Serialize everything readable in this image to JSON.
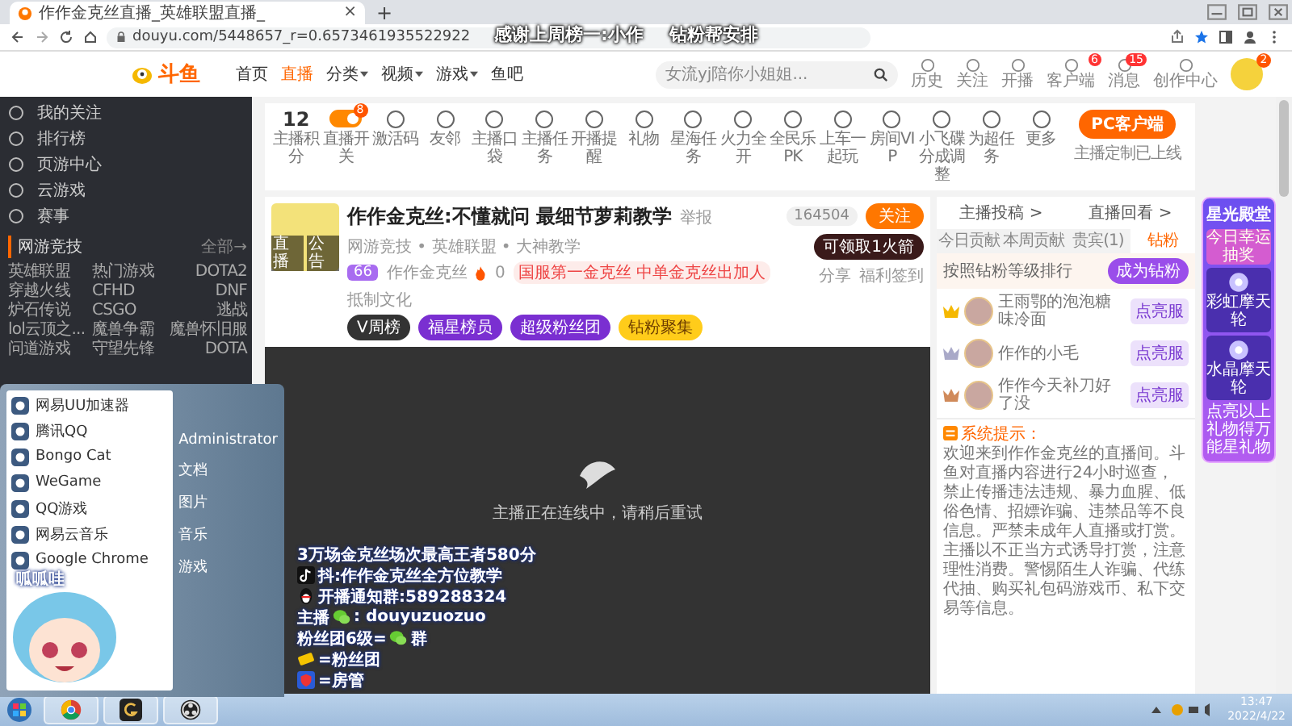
{
  "overlay_caption": [
    "感谢上周榜一:小作",
    "钻粉帮安排"
  ],
  "browser": {
    "tab_title": "作作金克丝直播_英雄联盟直播_",
    "tab_close": "×",
    "new_tab": "+",
    "url": "douyu.com/5448657_r=0.6573461935522922"
  },
  "site_header": {
    "logo": "斗鱼",
    "nav": [
      {
        "label": "首页",
        "selected": false,
        "dropdown": false
      },
      {
        "label": "直播",
        "selected": true,
        "dropdown": false
      },
      {
        "label": "分类",
        "selected": false,
        "dropdown": true
      },
      {
        "label": "视频",
        "selected": false,
        "dropdown": true
      },
      {
        "label": "游戏",
        "selected": false,
        "dropdown": true
      },
      {
        "label": "鱼吧",
        "selected": false,
        "dropdown": false
      }
    ],
    "search": {
      "placeholder": "女流yj陪你小姐姐..."
    },
    "actions": [
      {
        "label": "历史"
      },
      {
        "label": "关注"
      },
      {
        "label": "开播"
      },
      {
        "label": "客户端",
        "badge": "6"
      },
      {
        "label": "消息",
        "badge": "15"
      },
      {
        "label": "创作中心"
      }
    ],
    "avatar_badge": "2"
  },
  "sidebar": {
    "items": [
      {
        "label": "我的关注"
      },
      {
        "label": "排行榜"
      },
      {
        "label": "页游中心"
      },
      {
        "label": "云游戏"
      },
      {
        "label": "赛事"
      }
    ],
    "section": {
      "title": "网游竞技",
      "more": "全部→"
    },
    "games": [
      "英雄联盟",
      "热门游戏",
      "DOTA2",
      "穿越火线",
      "CFHD",
      "DNF",
      "炉石传说",
      "CSGO",
      "逃战",
      "lol云顶之...",
      "魔兽争霸",
      "魔兽怀旧服",
      "问道游戏",
      "守望先锋",
      "DOTA"
    ]
  },
  "toolbar": {
    "items": [
      {
        "kind": "score",
        "value": "12",
        "label": "主播积分"
      },
      {
        "kind": "toggle",
        "on": true,
        "badge": "8",
        "label": "直播开关"
      },
      {
        "kind": "icon",
        "label": "激活码"
      },
      {
        "kind": "icon",
        "label": "友邻"
      },
      {
        "kind": "icon",
        "label": "主播口袋"
      },
      {
        "kind": "icon",
        "label": "主播任务"
      },
      {
        "kind": "icon",
        "label": "开播提醒"
      },
      {
        "kind": "icon",
        "label": "礼物"
      },
      {
        "kind": "icon",
        "label": "星海任务"
      },
      {
        "kind": "icon",
        "label": "火力全开"
      },
      {
        "kind": "icon",
        "label": "全民乐PK"
      },
      {
        "kind": "icon",
        "label": "上车一起玩"
      },
      {
        "kind": "icon",
        "label": "房间VIP"
      },
      {
        "kind": "icon",
        "label": "小飞碟分成调整"
      },
      {
        "kind": "icon",
        "label": "为超任务"
      },
      {
        "kind": "icon",
        "label": "更多"
      }
    ],
    "client_button": "PC客户端",
    "client_note": "主播定制已上线"
  },
  "room": {
    "title": "作作金克丝:不懂就问 最细节萝莉教学",
    "report": "举报",
    "category": "网游竞技 • 英雄联盟 • 大神教学",
    "level": "66",
    "anchor": "作作金克丝",
    "heat": "0",
    "slogan": "国服第一金克丝 中单金克丝出加人",
    "culture": "抵制文化",
    "avatar_tags": [
      "直播",
      "公告"
    ],
    "tags": [
      {
        "label": "V周榜",
        "kind": "dark"
      },
      {
        "label": "福星榜员",
        "kind": "purple"
      },
      {
        "label": "超级粉丝团",
        "kind": "purple"
      },
      {
        "label": "钻粉聚集",
        "kind": "gold"
      }
    ],
    "followers": "164504",
    "follow_button": "关注",
    "rocket": "可领取1火箭",
    "share": "分享",
    "checkin": "福利签到"
  },
  "video": {
    "status": "主播正在连线中，请稍后重试"
  },
  "side_panel": {
    "links": [
      "主播投稿 >",
      "直播回看 >"
    ],
    "tabs": [
      {
        "label": "今日贡献",
        "selected": false
      },
      {
        "label": "本周贡献",
        "selected": false
      },
      {
        "label": "贵宾(1)",
        "selected": false
      },
      {
        "label": "钻粉",
        "selected": true
      }
    ],
    "rank_title": "按照钻粉等级排行",
    "join_button": "成为钻粉",
    "ranks": [
      {
        "name": "王雨鄂的泡泡糖味冷面",
        "color": "#f5b800",
        "action": "点亮服"
      },
      {
        "name": "作作的小毛",
        "color": "#a9a9c8",
        "action": "点亮服"
      },
      {
        "name": "作作今天补刀好了没",
        "color": "#d08a5a",
        "action": "点亮服"
      }
    ],
    "system": {
      "label": "系统提示：",
      "text": "欢迎来到作作金克丝的直播间。斗鱼对直播内容进行24小时巡查，禁止传播违法违规、暴力血腥、低俗色情、招嫖诈骗、违禁品等不良信息。严禁未成年人直播或打赏。主播以不正当方式诱导打赏，注意理性消费。警惕陌生人诈骗、代练代抽、购买礼包码游戏币、私下交易等信息。"
    }
  },
  "promo": {
    "title": "星光殿堂",
    "subtitle": "今日幸运抽奖",
    "gifts": [
      "彩虹摩天轮",
      "水晶摩天轮"
    ],
    "note": "点亮以上礼物得万能星礼物"
  },
  "start_menu": {
    "programs": [
      "网易UU加速器",
      "腾讯QQ",
      "Bongo Cat",
      "WeGame",
      "QQ游戏",
      "网易云音乐",
      "Google Chrome"
    ],
    "places": [
      "Administrator",
      "文档",
      "图片",
      "音乐",
      "游戏"
    ]
  },
  "streamer_overlay": {
    "greeting": "呱呱哇",
    "lines": [
      {
        "kind": "text",
        "after": "3万场金克丝场次最高王者580分"
      },
      {
        "kind": "tiktok",
        "after": "抖:作作金克丝全方位教学"
      },
      {
        "kind": "qq",
        "after": "开播通知群:589288324"
      },
      {
        "kind": "wechat",
        "before": "主播",
        "after": ": douyuzuozuo"
      },
      {
        "kind": "wechat",
        "before": "粉丝团6级=",
        "after": "群"
      },
      {
        "kind": "fanbadge",
        "after": "=粉丝团"
      },
      {
        "kind": "admin",
        "after": "=房管"
      }
    ]
  },
  "taskbar": {
    "apps": [
      {
        "kind": "chrome"
      },
      {
        "kind": "wegame"
      },
      {
        "kind": "obs"
      }
    ],
    "time": "13:47",
    "date": "2022/4/22"
  }
}
